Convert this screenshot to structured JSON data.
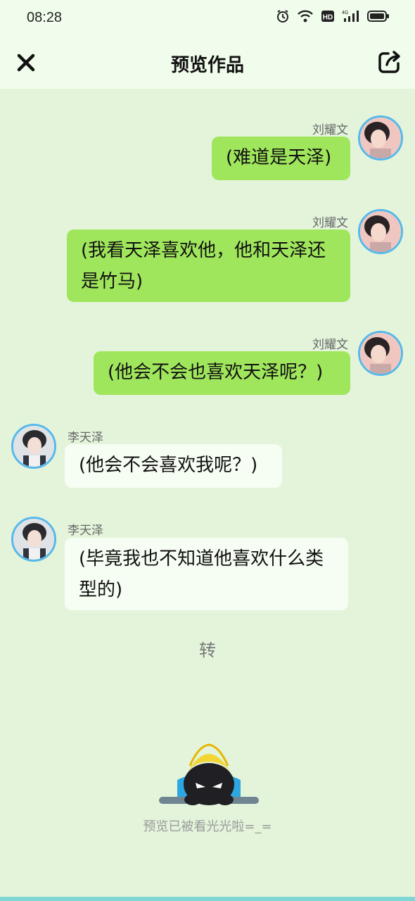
{
  "status_bar": {
    "time": "08:28",
    "icons": [
      "alarm-icon",
      "wifi-icon",
      "hd-icon",
      "signal-4g-icon",
      "battery-icon"
    ],
    "network_label": "4G",
    "hd_label": "HD"
  },
  "header": {
    "title": "预览作品",
    "close_icon": "close-icon",
    "share_icon": "share-icon"
  },
  "messages": [
    {
      "sender": "刘耀文",
      "side": "right",
      "text": "(难道是天泽)"
    },
    {
      "sender": "刘耀文",
      "side": "right",
      "text": "(我看天泽喜欢他，他和天泽还是竹马)"
    },
    {
      "sender": "刘耀文",
      "side": "right",
      "text": "(他会不会也喜欢天泽呢？)"
    },
    {
      "sender": "李天泽",
      "side": "left",
      "text": "(他会不会喜欢我呢？)"
    },
    {
      "sender": "李天泽",
      "side": "left",
      "text": "(毕竟我也不知道他喜欢什么类型的)"
    }
  ],
  "transition_text": "转",
  "end_message": "预览已被看光光啦=_=",
  "colors": {
    "background": "#e3f4db",
    "header_bg": "#f1fdec",
    "right_bubble": "#a0e65c",
    "left_bubble": "#f6fdf2",
    "avatar_border": "#57b8ea"
  }
}
